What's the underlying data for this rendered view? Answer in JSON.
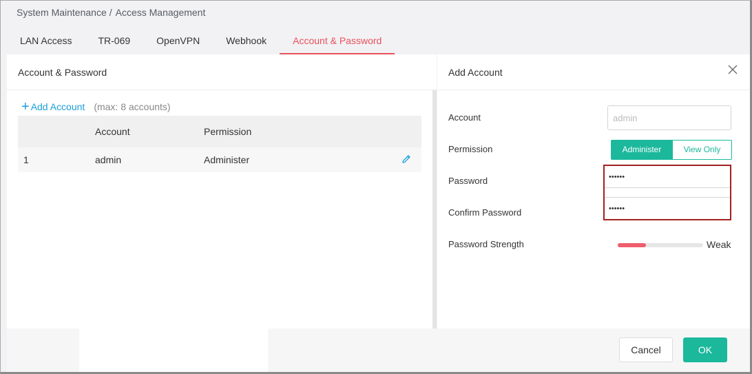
{
  "breadcrumb": {
    "parent": "System Maintenance",
    "separator": "/",
    "current": "Access Management"
  },
  "tabs": [
    {
      "label": "LAN Access"
    },
    {
      "label": "TR-069"
    },
    {
      "label": "OpenVPN"
    },
    {
      "label": "Webhook"
    },
    {
      "label": "Account & Password",
      "active": true
    }
  ],
  "left_panel": {
    "title": "Account & Password",
    "add_label": "Add Account",
    "add_hint": "(max: 8 accounts)",
    "columns": [
      "",
      "Account",
      "Permission"
    ],
    "rows": [
      {
        "index": "1",
        "account": "admin",
        "permission": "Administer"
      }
    ]
  },
  "right_panel": {
    "title": "Add Account",
    "account_label": "Account",
    "account_placeholder": "admin",
    "permission_label": "Permission",
    "permission_options": [
      "Administer",
      "View Only"
    ],
    "permission_selected": "Administer",
    "password_label": "Password",
    "password_value": "••••••",
    "confirm_label": "Confirm Password",
    "confirm_value": "••••••",
    "strength_label": "Password Strength",
    "strength_text": "Weak",
    "strength_level": 0.33
  },
  "footer": {
    "cancel": "Cancel",
    "ok": "OK"
  },
  "colors": {
    "accent": "#1bb89c",
    "active_tab": "#e8505b",
    "link": "#1a9fd9",
    "highlight_border": "#a32020",
    "strength_weak": "#ee5e6c"
  },
  "icons": {
    "add": "plus-icon",
    "edit": "pencil-icon",
    "close": "close-icon"
  }
}
